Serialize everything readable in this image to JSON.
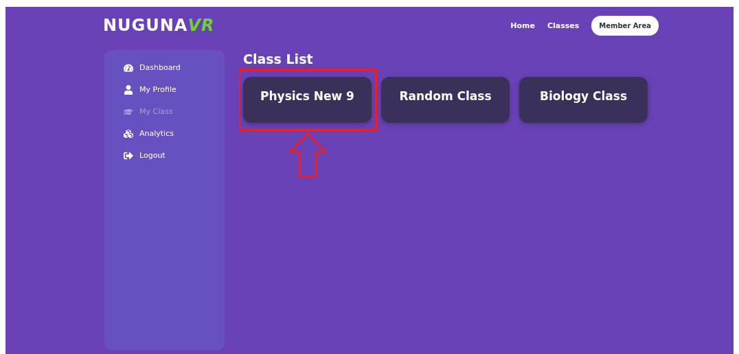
{
  "logo": {
    "word": "NUGUNA",
    "accent": "VR"
  },
  "nav": [
    {
      "label": "Home",
      "kind": "link"
    },
    {
      "label": "Classes",
      "kind": "link"
    },
    {
      "label": "Member Area",
      "kind": "button"
    }
  ],
  "sidebar": {
    "items": [
      {
        "label": "Dashboard",
        "kind": "dashboard",
        "selected": false
      },
      {
        "label": "My Profile",
        "kind": "profile",
        "selected": false
      },
      {
        "label": "My Class",
        "kind": "class",
        "selected": true
      },
      {
        "label": "Analytics",
        "kind": "analytics",
        "selected": false
      },
      {
        "label": "Logout",
        "kind": "logout",
        "selected": false
      }
    ]
  },
  "class_list": {
    "title": "Class List",
    "classes": [
      {
        "name": "Physics New 9",
        "highlighted": true
      },
      {
        "name": "Random Class",
        "highlighted": false
      },
      {
        "name": "Biology Class",
        "highlighted": false
      }
    ]
  }
}
